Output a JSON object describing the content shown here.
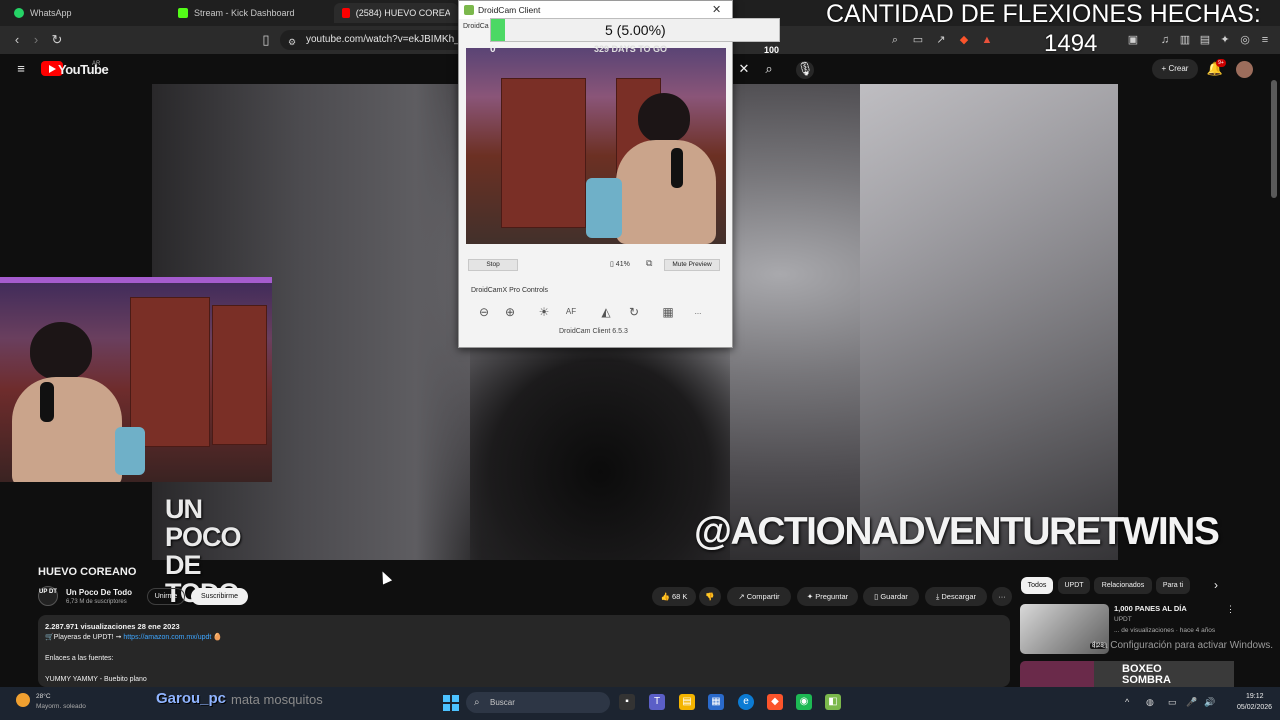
{
  "browser": {
    "tabs": [
      {
        "label": "WhatsApp",
        "color": "#25d366"
      },
      {
        "label": "Stream - Kick Dashboard",
        "color": "#53fc18"
      },
      {
        "label": "(2584) HUEVO COREANO - Y",
        "color": "#ff0000"
      }
    ],
    "url": "youtube.com/watch?v=ekJBIMKh_qA"
  },
  "overlay": {
    "pushups_title": "CANTIDAD DE FLEXIONES HECHAS:",
    "pushups_count": "1494"
  },
  "droidcam": {
    "title": "DroidCam Client",
    "left_label": "DroidCa",
    "progress_text": "5 (5.00%)",
    "progress_fraction": 0.05,
    "progress_min": "0",
    "progress_max": "100",
    "days_text": "329 DAYS TO GO",
    "stop_label": "Stop",
    "battery_text": "41%",
    "mute_label": "Mute Preview",
    "pro_label": "DroidCamX Pro Controls",
    "tool_more": "...",
    "version": "DroidCam Client 6.5.3"
  },
  "youtube": {
    "logo_text": "YouTube",
    "country": "AR",
    "create_label": "+ Crear",
    "notif_count": "9+",
    "video": {
      "watermark_left": "UN POCO DE TODO",
      "watermark_right": "@ACTIONADVENTURETWINS"
    },
    "title": "HUEVO COREANO",
    "channel": {
      "avatar_text": "UP DT",
      "name": "Un Poco De Todo",
      "subs": "6,73 M de suscriptores",
      "join_label": "Unirme",
      "subscribe_label": "Suscribirme"
    },
    "actions": {
      "likes": "68 K",
      "share": "Compartir",
      "ask": "Preguntar",
      "save": "Guardar",
      "download": "Descargar",
      "more": "···"
    },
    "description": {
      "meta": "2.287.971 visualizaciones  28 ene 2023",
      "line1_prefix": "🛒Playeras de UPDT! ➞ ",
      "line1_link": "https://amazon.com.mx/updt",
      "line1_suffix": " 🥚",
      "line2": "Enlaces a las fuentes:",
      "line3": "YUMMY YAMMY - Buebito plano"
    },
    "chips": [
      "Todos",
      "UPDT",
      "Relacionados",
      "Para ti"
    ],
    "recommended": {
      "title": "1,000 PANES AL DÍA",
      "channel": "UPDT",
      "meta": "... de visualizaciones · hace 4 años",
      "duration": "8:28",
      "next_title": "BOXEO SOMBRA"
    },
    "activate_windows": "Ir a Configuración para activar Windows."
  },
  "taskbar": {
    "weather_temp": "28°C",
    "weather_desc": "Mayorm. soleado",
    "overlay_user": "Garou_pc",
    "overlay_msg": "mata mosquitos",
    "search_placeholder": "Buscar",
    "time": "19:12",
    "date": "05/02/2026"
  }
}
